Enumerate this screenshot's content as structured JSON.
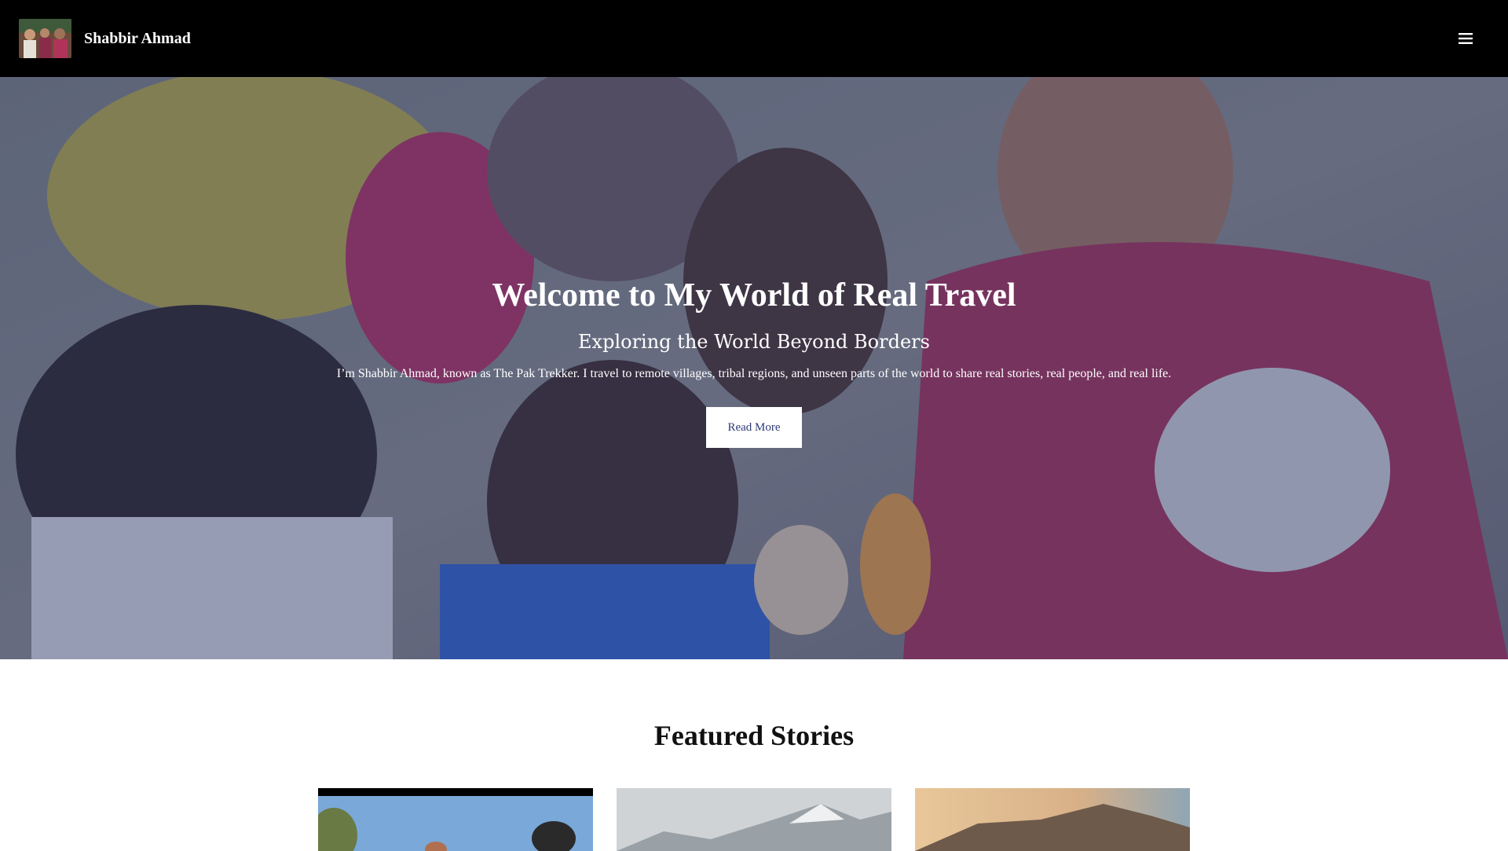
{
  "navbar": {
    "brand_name": "Shabbir Ahmad",
    "menu_icon": "hamburger-menu-icon"
  },
  "hero": {
    "title": "Welcome to My World of Real Travel",
    "subtitle": "Exploring the World Beyond Borders",
    "description": "I’m Shabbir Ahmad, known as The Pak Trekker. I travel to remote villages, tribal regions, and unseen parts of the world to share real stories, real people, and real life.",
    "button_label": "Read More",
    "overlay_color": "#2e3a76"
  },
  "featured": {
    "title": "Featured Stories"
  },
  "colors": {
    "navbar_bg": "#000000",
    "button_text": "#2e3a76"
  }
}
